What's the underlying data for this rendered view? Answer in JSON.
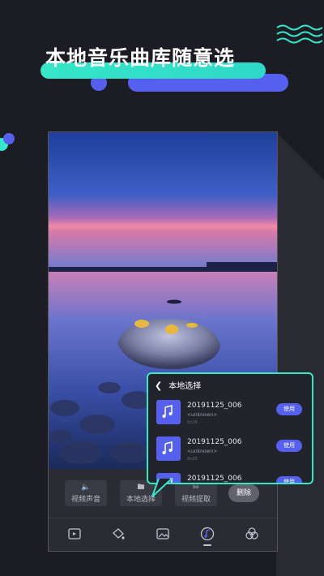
{
  "headline": "本地音乐曲库随意选",
  "colors": {
    "accent_teal": "#36e6c7",
    "accent_blue": "#5560ee",
    "background": "#1c1c24"
  },
  "toolbar": {
    "video_audio_label": "视频声音",
    "local_select_label": "本地选择",
    "video_extract_label": "视频提取",
    "delete_label": "删除"
  },
  "bottom_nav": {
    "icons": [
      "video-add-icon",
      "paint-bucket-icon",
      "image-icon",
      "music-disc-icon",
      "filter-icon"
    ]
  },
  "popup": {
    "title": "本地选择",
    "songs": [
      {
        "title": "20191125_006",
        "artist": "<unknown>",
        "meta": "0n26",
        "use_label": "使用"
      },
      {
        "title": "20191125_006",
        "artist": "<unknown>",
        "meta": "0n26",
        "use_label": "使用"
      },
      {
        "title": "20191125_006",
        "artist": "",
        "meta": "",
        "use_label": "使用"
      }
    ]
  }
}
